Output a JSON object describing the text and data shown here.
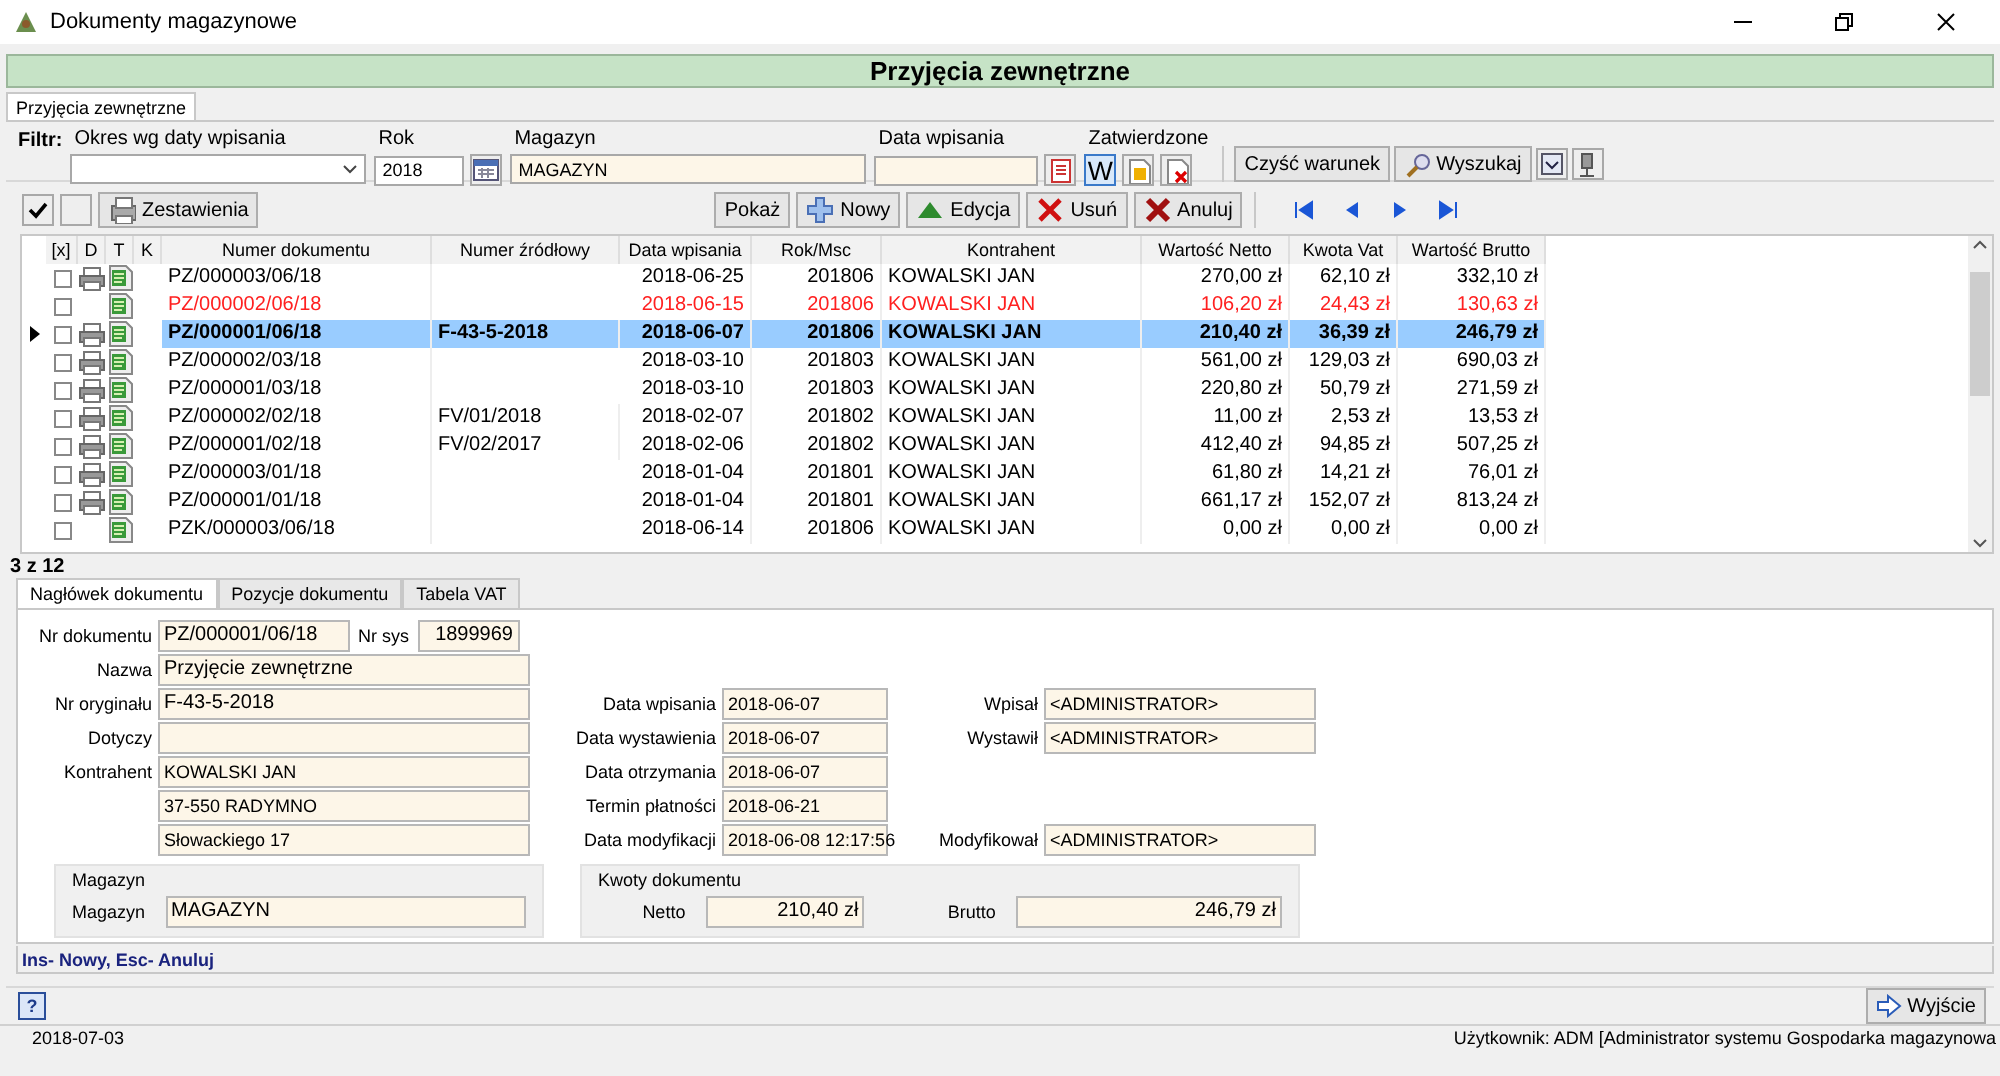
{
  "window": {
    "title": "Dokumenty magazynowe"
  },
  "header": {
    "title": "Przyjęcia zewnętrzne"
  },
  "tabs": [
    {
      "label": "Przyjęcia zewnętrzne",
      "selected": true
    }
  ],
  "filter": {
    "label": "Filtr:",
    "fields": [
      {
        "kind": "combo",
        "label": "Okres wg daty wpisania"
      },
      {
        "kind": "year",
        "label": "Rok",
        "value": "2018"
      },
      {
        "kind": "text",
        "label": "Magazyn",
        "value": "MAGAZYN"
      },
      {
        "kind": "date",
        "label": "Data wpisania"
      }
    ],
    "approved": {
      "label": "Zatwierdzone",
      "toggles": [
        {
          "kind": "text",
          "label": "W",
          "selected": true
        },
        {
          "kind": "doc",
          "selected": false
        },
        {
          "kind": "doc-x",
          "selected": false
        }
      ]
    },
    "buttons": [
      {
        "kind": "plain",
        "label": "Czyść warunek"
      },
      {
        "kind": "search",
        "label": "Wyszukaj"
      },
      {
        "kind": "dropdown"
      },
      {
        "kind": "tool"
      }
    ]
  },
  "toolbar": {
    "select_boxes": [
      {
        "checked": true
      },
      {
        "checked": false
      }
    ],
    "buttons": [
      {
        "kind": "report",
        "label": "Zestawienia"
      },
      {
        "kind": "show",
        "label": "Pokaż"
      },
      {
        "kind": "new",
        "label": "Nowy"
      },
      {
        "kind": "edit",
        "label": "Edycja"
      },
      {
        "kind": "delete",
        "label": "Usuń"
      },
      {
        "kind": "cancel",
        "label": "Anuluj"
      }
    ],
    "nav": [
      {
        "kind": "first"
      },
      {
        "kind": "prev"
      },
      {
        "kind": "next"
      },
      {
        "kind": "last"
      }
    ]
  },
  "table": {
    "columns": [
      "[x]",
      "D",
      "T",
      "K",
      "Numer dokumentu",
      "Numer źródłowy",
      "Data wpisania",
      "Rok/Msc",
      "Kontrahent",
      "Wartość Netto",
      "Kwota Vat",
      "Wartość Brutto"
    ],
    "rows": [
      {
        "checked": false,
        "printed": true,
        "document": true,
        "number": "PZ/000003/06/18",
        "date": "2018-06-25",
        "period": "201806",
        "contractor": "KOWALSKI JAN",
        "net": "270,00 zł",
        "vat": "62,10 zł",
        "gross": "332,10 zł",
        "flagged": false,
        "selected": false
      },
      {
        "checked": false,
        "printed": false,
        "document": true,
        "number": "PZ/000002/06/18",
        "date": "2018-06-15",
        "period": "201806",
        "contractor": "KOWALSKI JAN",
        "net": "106,20 zł",
        "vat": "24,43 zł",
        "gross": "130,63 zł",
        "flagged": true,
        "selected": false
      },
      {
        "checked": false,
        "printed": true,
        "document": true,
        "number": "PZ/000001/06/18",
        "source": "F-43-5-2018",
        "date": "2018-06-07",
        "period": "201806",
        "contractor": "KOWALSKI JAN",
        "net": "210,40 zł",
        "vat": "36,39 zł",
        "gross": "246,79 zł",
        "flagged": false,
        "selected": true
      },
      {
        "checked": false,
        "printed": true,
        "document": true,
        "number": "PZ/000002/03/18",
        "date": "2018-03-10",
        "period": "201803",
        "contractor": "KOWALSKI JAN",
        "net": "561,00 zł",
        "vat": "129,03 zł",
        "gross": "690,03 zł",
        "flagged": false,
        "selected": false
      },
      {
        "checked": false,
        "printed": true,
        "document": true,
        "number": "PZ/000001/03/18",
        "date": "2018-03-10",
        "period": "201803",
        "contractor": "KOWALSKI JAN",
        "net": "220,80 zł",
        "vat": "50,79 zł",
        "gross": "271,59 zł",
        "flagged": false,
        "selected": false
      },
      {
        "checked": false,
        "printed": true,
        "document": true,
        "number": "PZ/000002/02/18",
        "source": "FV/01/2018",
        "date": "2018-02-07",
        "period": "201802",
        "contractor": "KOWALSKI JAN",
        "net": "11,00 zł",
        "vat": "2,53 zł",
        "gross": "13,53 zł",
        "flagged": false,
        "selected": false
      },
      {
        "checked": false,
        "printed": true,
        "document": true,
        "number": "PZ/000001/02/18",
        "source": "FV/02/2017",
        "date": "2018-02-06",
        "period": "201802",
        "contractor": "KOWALSKI JAN",
        "net": "412,40 zł",
        "vat": "94,85 zł",
        "gross": "507,25 zł",
        "flagged": false,
        "selected": false
      },
      {
        "checked": false,
        "printed": true,
        "document": true,
        "number": "PZ/000003/01/18",
        "date": "2018-01-04",
        "period": "201801",
        "contractor": "KOWALSKI JAN",
        "net": "61,80 zł",
        "vat": "14,21 zł",
        "gross": "76,01 zł",
        "flagged": false,
        "selected": false
      },
      {
        "checked": false,
        "printed": true,
        "document": true,
        "number": "PZ/000001/01/18",
        "date": "2018-01-04",
        "period": "201801",
        "contractor": "KOWALSKI JAN",
        "net": "661,17 zł",
        "vat": "152,07 zł",
        "gross": "813,24 zł",
        "flagged": false,
        "selected": false
      },
      {
        "checked": false,
        "printed": false,
        "document": true,
        "number": "PZK/000003/06/18",
        "date": "2018-06-14",
        "period": "201806",
        "contractor": "KOWALSKI JAN",
        "net": "0,00 zł",
        "vat": "0,00 zł",
        "gross": "0,00 zł",
        "flagged": false,
        "selected": false
      }
    ]
  },
  "record_count": "3 z 12",
  "detail_tabs": [
    {
      "label": "Nagłówek dokumentu",
      "selected": true
    },
    {
      "label": "Pozycje dokumentu",
      "selected": false
    },
    {
      "label": "Tabela VAT",
      "selected": false
    }
  ],
  "detail": {
    "number": {
      "label": "Nr dokumentu",
      "value": "PZ/000001/06/18"
    },
    "sys": {
      "label": "Nr sys",
      "value": "1899969"
    },
    "name": {
      "label": "Nazwa",
      "value": "Przyjęcie zewnętrzne"
    },
    "original": {
      "label": "Nr oryginału",
      "value": "F-43-5-2018"
    },
    "concerns": {
      "label": "Dotyczy"
    },
    "contractor": {
      "label": "Kontrahent",
      "lines": [
        "KOWALSKI JAN",
        "37-550 RADYMNO",
        "Słowackiego 17"
      ]
    },
    "dates": [
      {
        "label": "Data wpisania",
        "value": "2018-06-07",
        "user": {
          "label": "Wpisał",
          "value": "<ADMINISTRATOR>"
        }
      },
      {
        "label": "Data wystawienia",
        "value": "2018-06-07",
        "user": {
          "label": "Wystawił",
          "value": "<ADMINISTRATOR>"
        }
      },
      {
        "label": "Data otrzymania",
        "value": "2018-06-07"
      },
      {
        "label": "Termin płatności",
        "value": "2018-06-21"
      },
      {
        "label": "Data modyfikacji",
        "value": "2018-06-08 12:17:56",
        "user": {
          "label": "Modyfikował",
          "value": "<ADMINISTRATOR>"
        }
      }
    ],
    "warehouse": {
      "title": "Magazyn",
      "label": "Magazyn",
      "value": "MAGAZYN"
    },
    "amounts": {
      "title": "Kwoty dokumentu",
      "net": {
        "label": "Netto",
        "value": "210,40 zł"
      },
      "gross": {
        "label": "Brutto",
        "value": "246,79 zł"
      }
    }
  },
  "hint": "Ins- Nowy, Esc- Anuluj",
  "footer": {
    "help": "?",
    "exit": "Wyjście"
  },
  "status_bar": [
    "2018-07-03",
    "Użytkownik: ADM [Administrator systemu Gospodarka magazynowa"
  ]
}
